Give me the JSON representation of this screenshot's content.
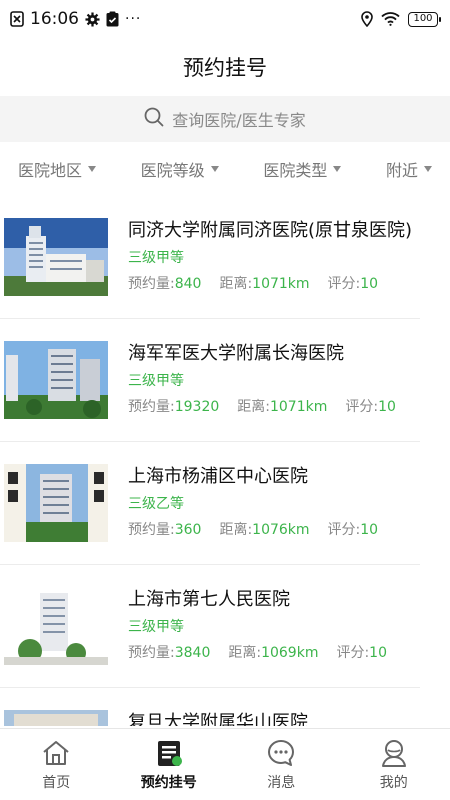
{
  "status_bar": {
    "time": "16:06",
    "more": "···",
    "battery": "100"
  },
  "header": {
    "title": "预约挂号"
  },
  "search": {
    "placeholder": "查询医院/医生专家"
  },
  "filters": [
    "医院地区",
    "医院等级",
    "医院类型",
    "附近"
  ],
  "hospitals": [
    {
      "name": "同济大学附属同济医院(原甘泉医院)",
      "level": "三级甲等",
      "appt_label": "预约量:",
      "appt": "840",
      "dist_label": "距离:",
      "dist": "1071km",
      "score_label": "评分:",
      "score": "10"
    },
    {
      "name": "海军军医大学附属长海医院",
      "level": "三级甲等",
      "appt_label": "预约量:",
      "appt": "19320",
      "dist_label": "距离:",
      "dist": "1071km",
      "score_label": "评分:",
      "score": "10"
    },
    {
      "name": "上海市杨浦区中心医院",
      "level": "三级乙等",
      "appt_label": "预约量:",
      "appt": "360",
      "dist_label": "距离:",
      "dist": "1076km",
      "score_label": "评分:",
      "score": "10"
    },
    {
      "name": "上海市第七人民医院",
      "level": "三级甲等",
      "appt_label": "预约量:",
      "appt": "3840",
      "dist_label": "距离:",
      "dist": "1069km",
      "score_label": "评分:",
      "score": "10"
    },
    {
      "name": "复旦大学附属华山医院",
      "level": "",
      "appt_label": "",
      "appt": "",
      "dist_label": "",
      "dist": "",
      "score_label": "",
      "score": ""
    }
  ],
  "tabs": [
    {
      "label": "首页",
      "icon": "home-icon",
      "active": false
    },
    {
      "label": "预约挂号",
      "icon": "appointment-icon",
      "active": true
    },
    {
      "label": "消息",
      "icon": "message-icon",
      "active": false
    },
    {
      "label": "我的",
      "icon": "profile-icon",
      "active": false
    }
  ],
  "colors": {
    "accent": "#3cb44b",
    "search_bg": "#f4f4f4",
    "text_muted": "#888888"
  }
}
